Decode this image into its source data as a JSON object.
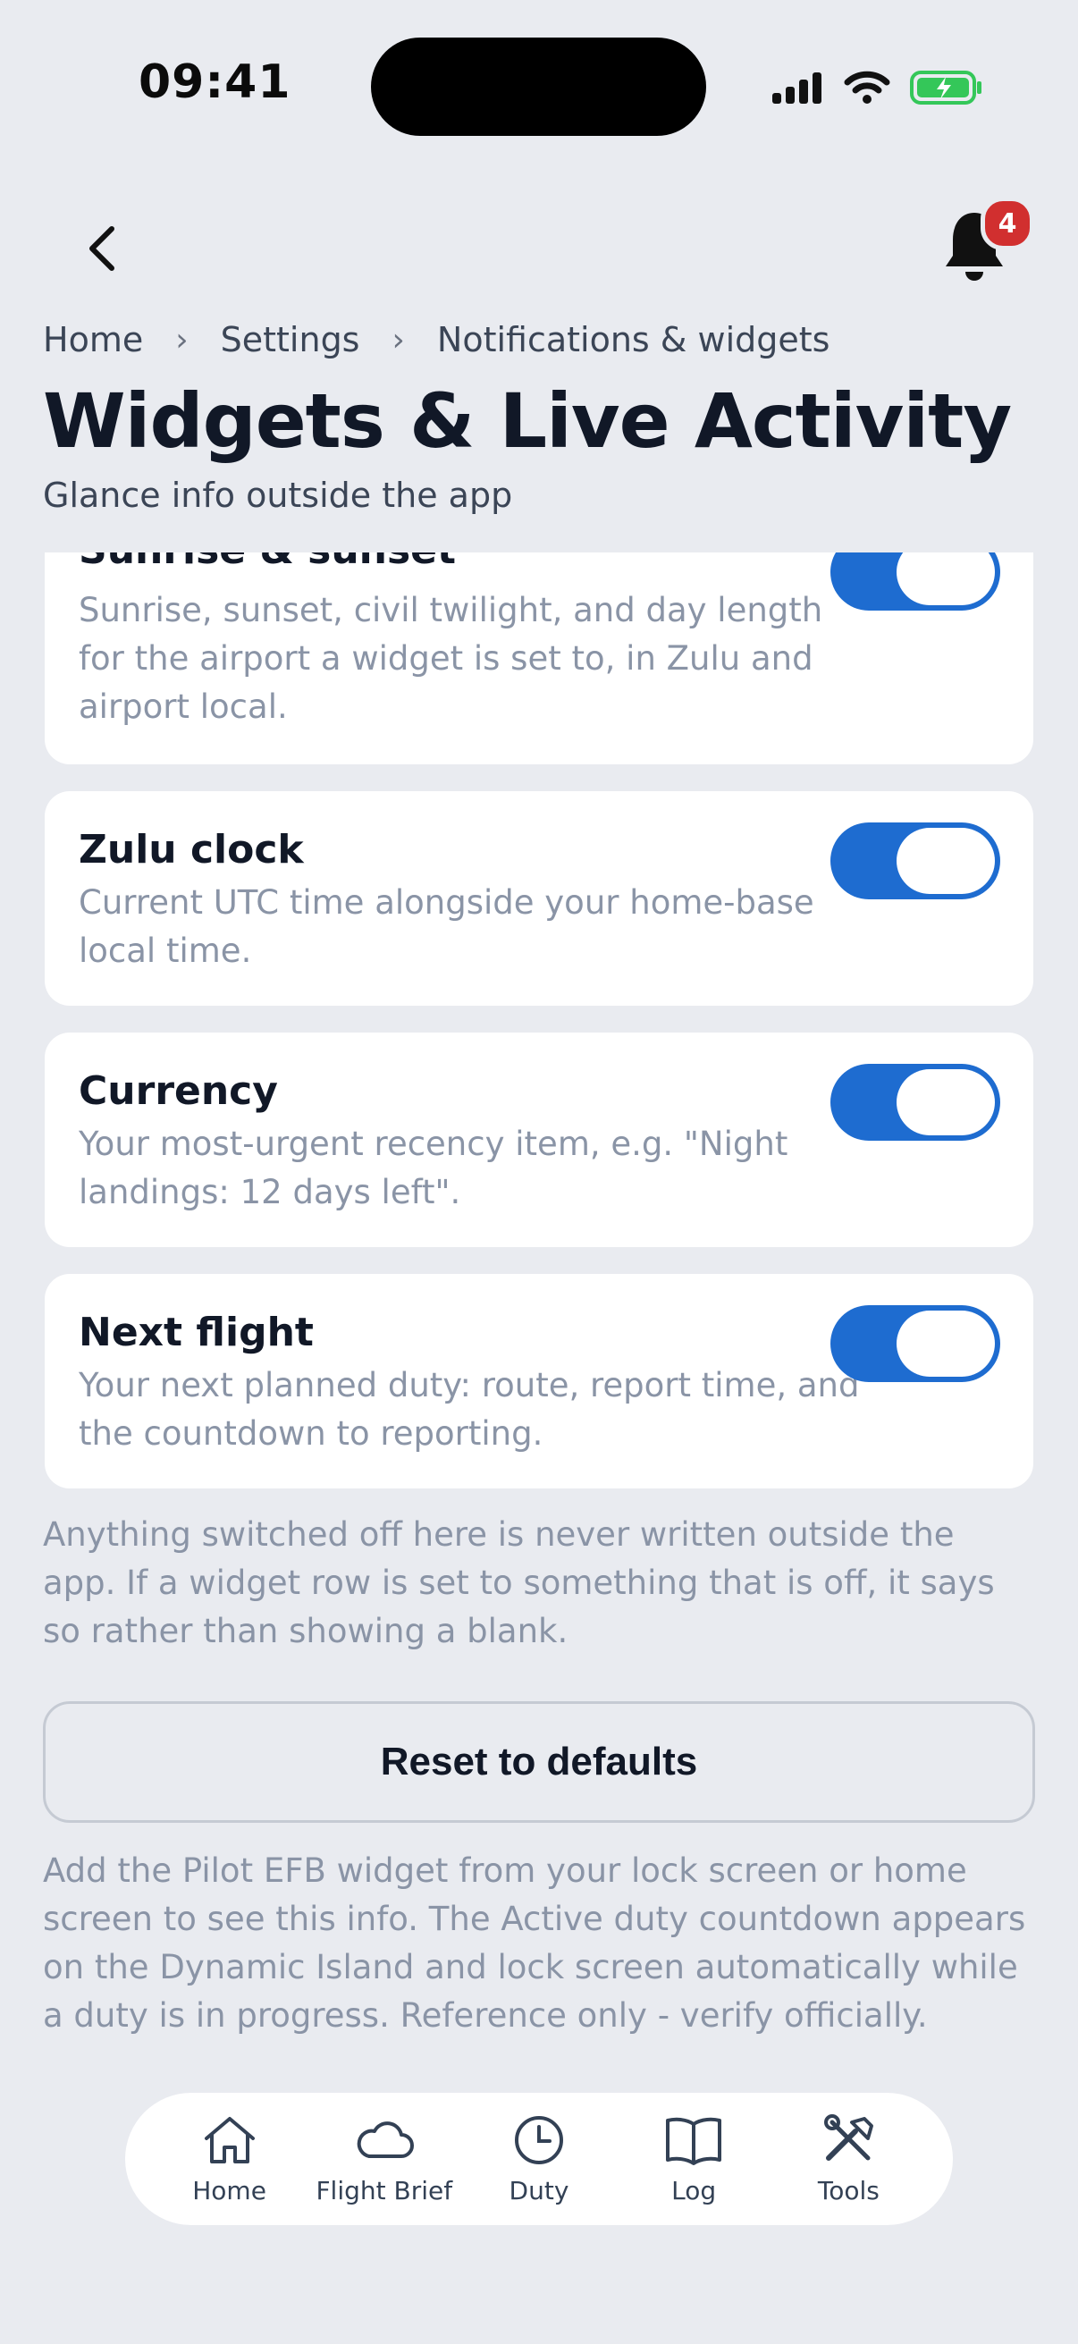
{
  "status_bar": {
    "time": "09:41"
  },
  "header": {
    "notification_count": "4"
  },
  "breadcrumb": [
    "Home",
    "Settings",
    "Notifications & widgets"
  ],
  "page": {
    "title": "Widgets & Live Activity",
    "subtitle": "Glance info outside the app"
  },
  "toggles": [
    {
      "title": "Sunrise & sunset",
      "desc": "Sunrise, sunset, civil twilight, and day length for the airport a widget is set to, in Zulu and airport local.",
      "on": true
    },
    {
      "title": "Zulu clock",
      "desc": "Current UTC time alongside your home-base local time.",
      "on": true
    },
    {
      "title": "Currency",
      "desc": "Your most-urgent recency item, e.g. \"Night landings: 12 days left\".",
      "on": true
    },
    {
      "title": "Next flight",
      "desc": "Your next planned duty: route, report time, and the countdown to reporting.",
      "on": true
    }
  ],
  "note": "Anything switched off here is never written outside the app. If a widget row is set to something that is off, it says so rather than showing a blank.",
  "reset_label": "Reset to defaults",
  "footer_note": "Add the Pilot EFB widget from your lock screen or home screen to see this info. The Active duty countdown appears on the Dynamic Island and lock screen automatically while a duty is in progress. Reference only - verify officially.",
  "tabs": [
    {
      "label": "Home",
      "icon": "home-icon"
    },
    {
      "label": "Flight Brief",
      "icon": "cloud-icon"
    },
    {
      "label": "Duty",
      "icon": "clock-icon"
    },
    {
      "label": "Log",
      "icon": "book-icon"
    },
    {
      "label": "Tools",
      "icon": "tools-icon"
    }
  ],
  "colors": {
    "accent": "#1e6cd0",
    "badge": "#d12f2f",
    "background": "#e9ebf0",
    "battery": "#34c759"
  }
}
